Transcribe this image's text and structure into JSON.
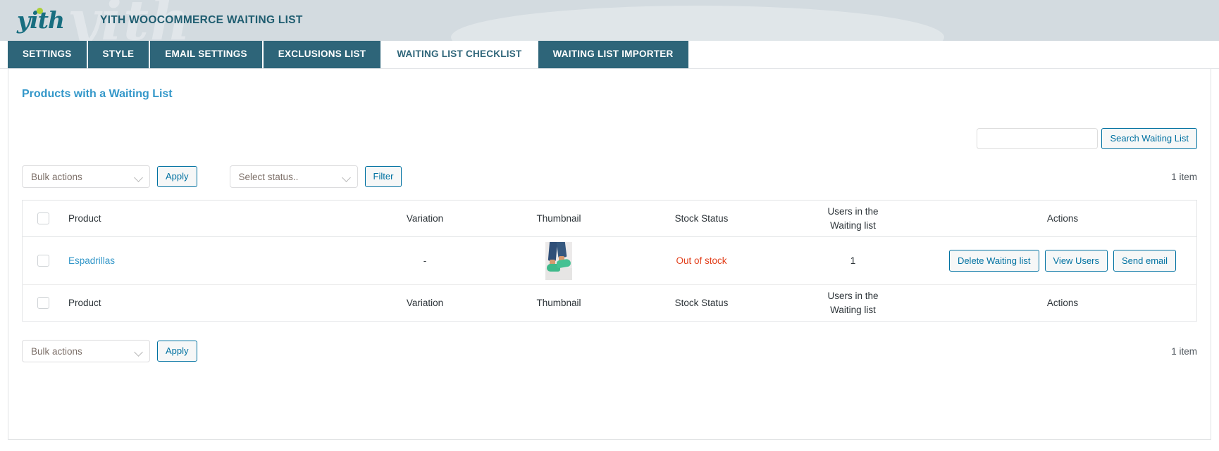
{
  "header": {
    "logo_text": "yith",
    "title": "YITH WOOCOMMERCE WAITING LIST"
  },
  "tabs": [
    {
      "label": "SETTINGS",
      "active": false
    },
    {
      "label": "STYLE",
      "active": false
    },
    {
      "label": "EMAIL SETTINGS",
      "active": false
    },
    {
      "label": "EXCLUSIONS LIST",
      "active": false
    },
    {
      "label": "WAITING LIST CHECKLIST",
      "active": true
    },
    {
      "label": "WAITING LIST IMPORTER",
      "active": false
    }
  ],
  "page": {
    "heading": "Products with a Waiting List"
  },
  "search": {
    "value": "",
    "placeholder": "",
    "button_label": "Search Waiting List"
  },
  "toolbar_top": {
    "bulk_actions_label": "Bulk actions",
    "apply_label": "Apply",
    "status_label": "Select status..",
    "filter_label": "Filter",
    "count_label": "1 item"
  },
  "toolbar_bottom": {
    "bulk_actions_label": "Bulk actions",
    "apply_label": "Apply",
    "count_label": "1 item"
  },
  "table": {
    "columns": {
      "product": "Product",
      "variation": "Variation",
      "thumbnail": "Thumbnail",
      "stock_status": "Stock Status",
      "users_line1": "Users in the",
      "users_line2": "Waiting list",
      "actions": "Actions"
    },
    "rows": [
      {
        "product": "Espadrillas",
        "variation": "-",
        "thumbnail_alt": "espadrillas-thumbnail",
        "stock_status": "Out of stock",
        "users_count": "1",
        "actions": {
          "delete_label": "Delete Waiting list",
          "view_users_label": "View Users",
          "send_email_label": "Send email"
        }
      }
    ]
  },
  "colors": {
    "tab_active_text": "#2e6579",
    "tab_bg": "#2e6579",
    "heading": "#3397c9",
    "link": "#3397c9",
    "out_of_stock": "#e2401c",
    "button_border": "#0071a1",
    "header_bg": "#d3dbe0"
  }
}
